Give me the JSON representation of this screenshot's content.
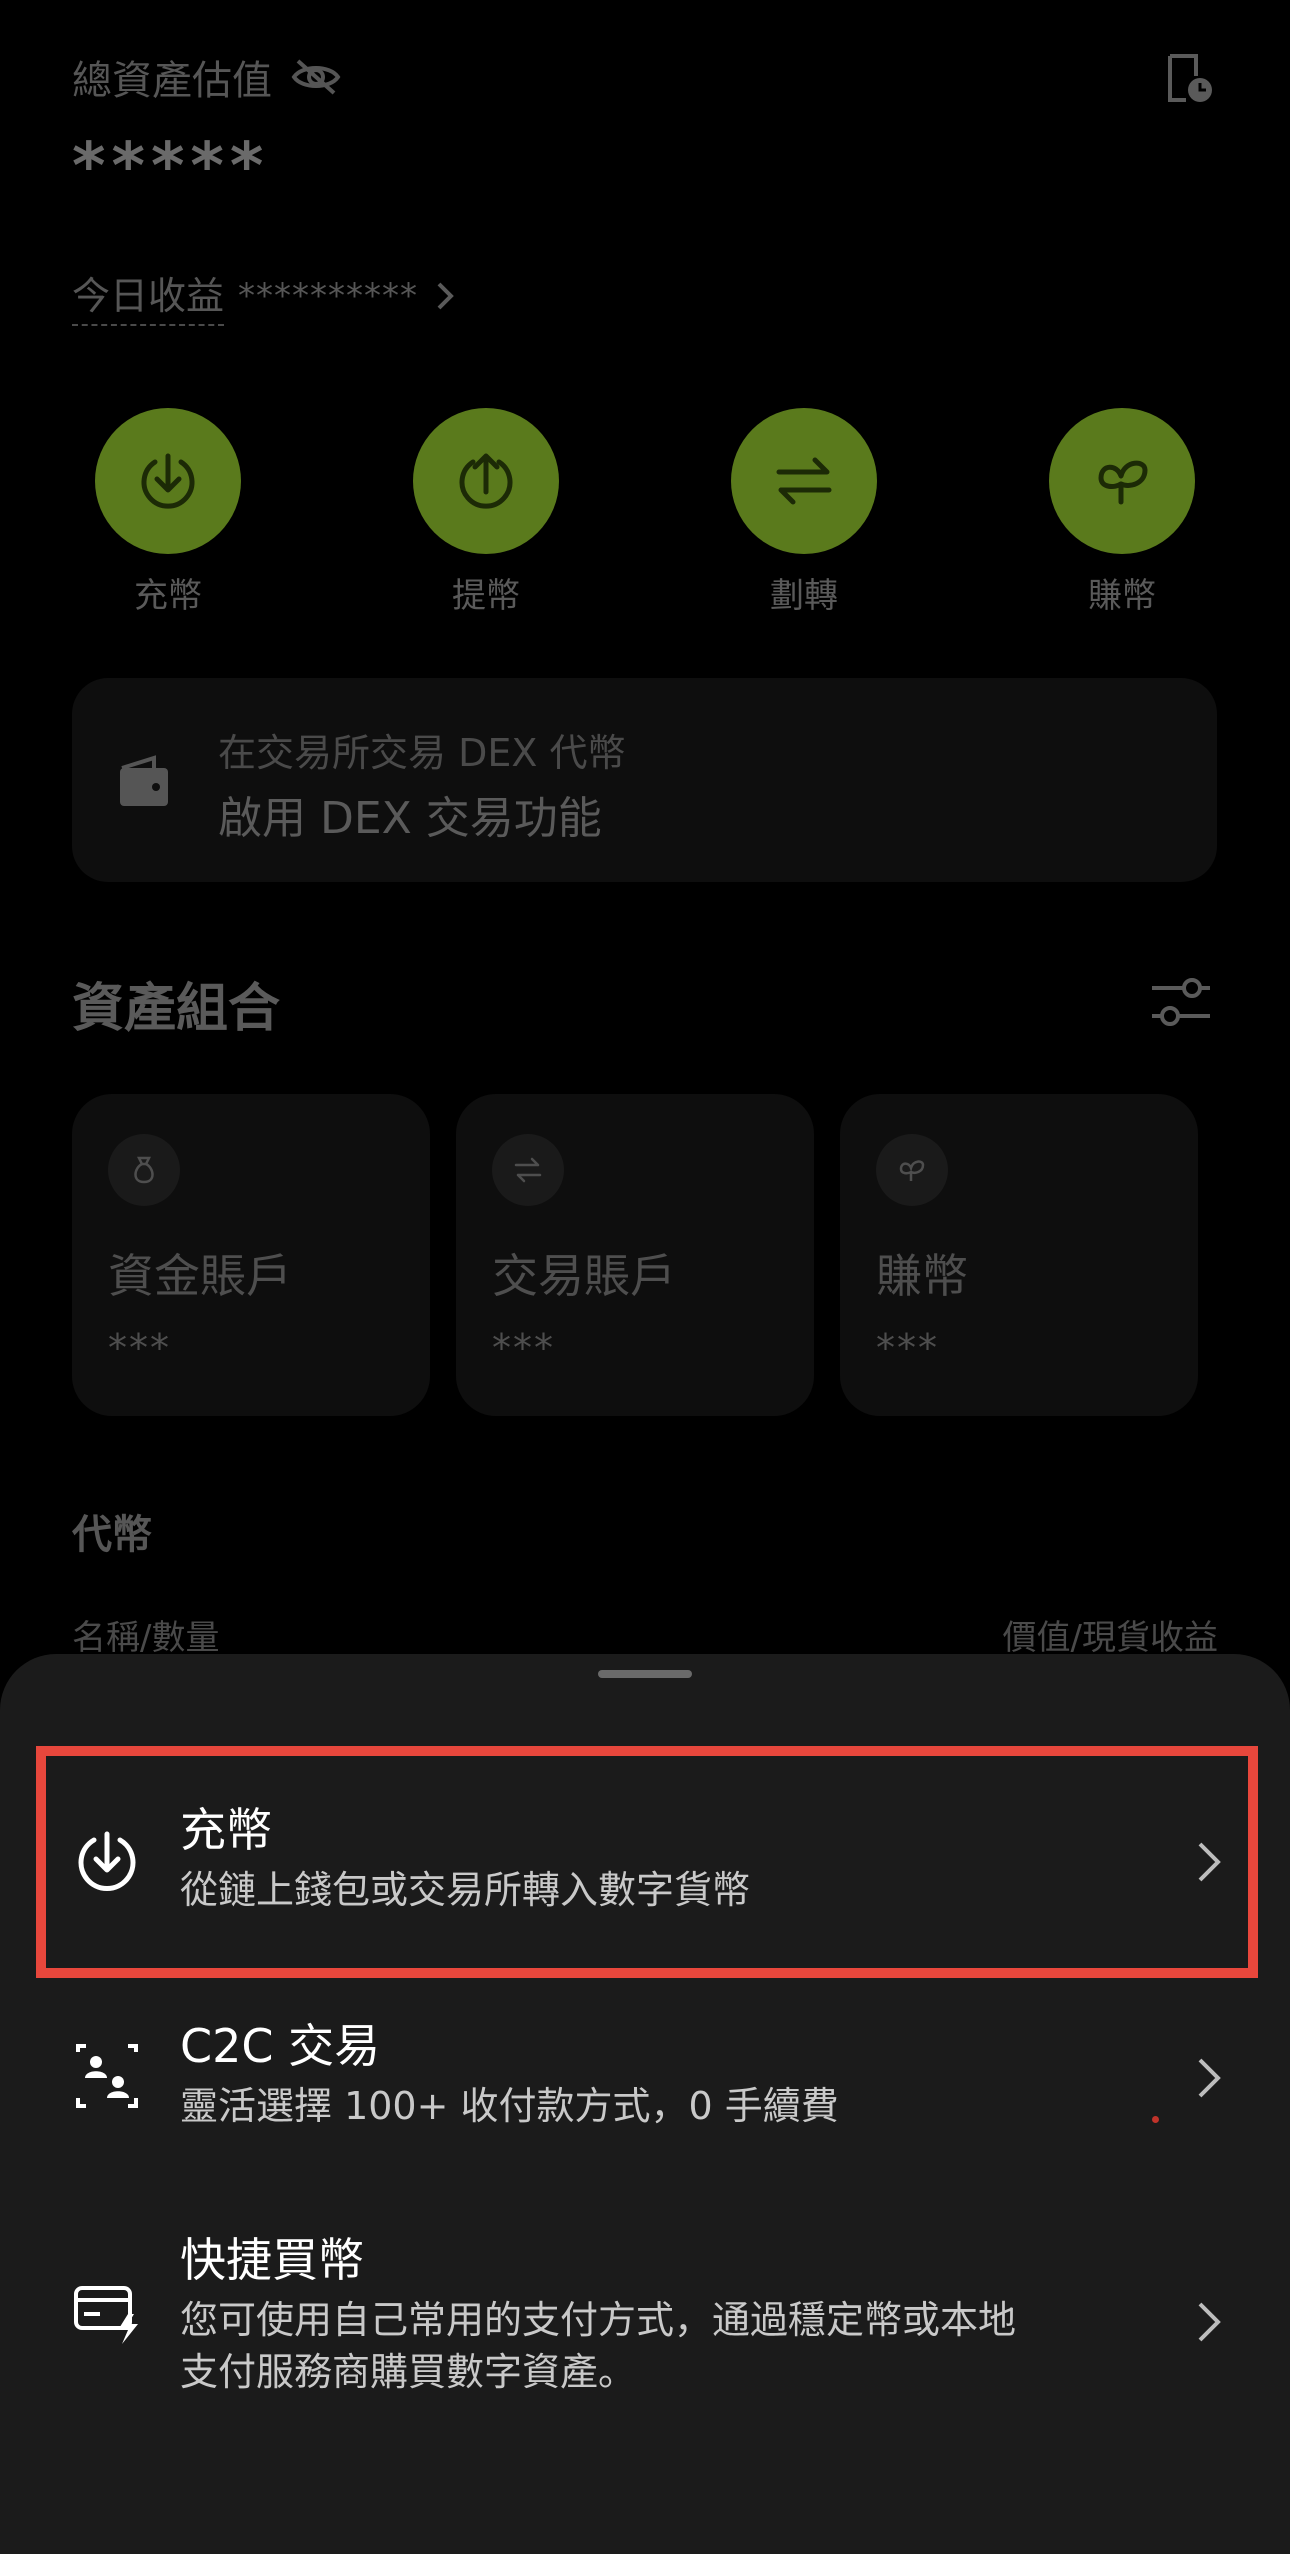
{
  "header": {
    "total_assets_label": "總資產估值",
    "total_assets_value": "*****",
    "today_pnl_label": "今日收益",
    "today_pnl_value": "**********"
  },
  "actions": [
    {
      "label": "充幣",
      "icon": "deposit-icon"
    },
    {
      "label": "提幣",
      "icon": "withdraw-icon"
    },
    {
      "label": "劃轉",
      "icon": "transfer-icon"
    },
    {
      "label": "賺幣",
      "icon": "earn-leaf-icon"
    }
  ],
  "action_color": "#5a7a1c",
  "dex_banner": {
    "line1": "在交易所交易 DEX 代幣",
    "line2": "啟用 DEX 交易功能"
  },
  "portfolio": {
    "title": "資產組合",
    "accounts": [
      {
        "name": "資金賬戶",
        "value": "***",
        "icon": "money-bag-icon"
      },
      {
        "name": "交易賬戶",
        "value": "***",
        "icon": "swap-icon"
      },
      {
        "name": "賺幣",
        "value": "***",
        "icon": "leaf-icon"
      }
    ]
  },
  "tokens": {
    "title": "代幣",
    "col_left": "名稱/數量",
    "col_right": "價值/現貨收益"
  },
  "sheet": {
    "items": [
      {
        "title": "充幣",
        "desc": "從鏈上錢包或交易所轉入數字貨幣",
        "icon": "deposit-icon"
      },
      {
        "title": "C2C 交易",
        "desc": "靈活選擇 100+ 收付款方式，0 手續費",
        "icon": "c2c-users-icon"
      },
      {
        "title": "快捷買幣",
        "desc1": "您可使用自己常用的支付方式，通過穩定幣或本地",
        "desc2": "支付服務商購買數字資產。",
        "icon": "card-fast-icon"
      }
    ],
    "highlight_color": "#e8473c"
  }
}
